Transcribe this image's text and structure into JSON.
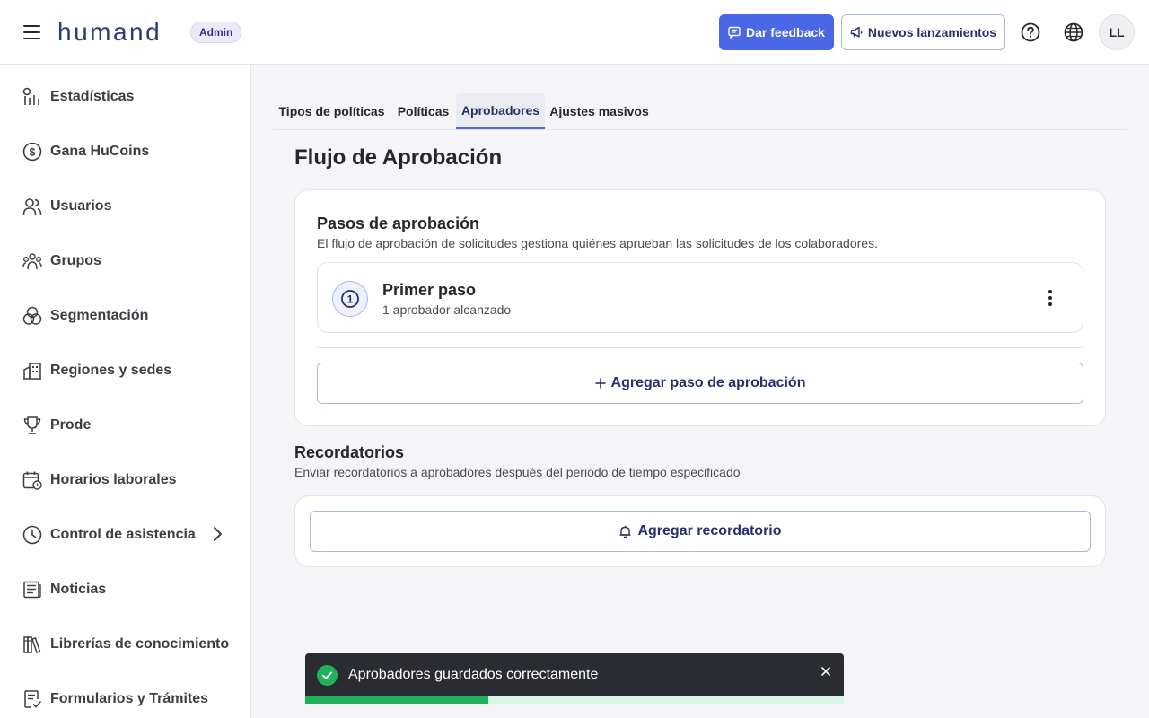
{
  "header": {
    "logo": "humand",
    "badge": "Admin",
    "feedback_label": "Dar feedback",
    "launches_label": "Nuevos lanzamientos",
    "avatar_initials": "LL"
  },
  "sidebar": {
    "items": [
      {
        "label": "Estadísticas",
        "icon": "chart-icon"
      },
      {
        "label": "Gana HuCoins",
        "icon": "coin-icon"
      },
      {
        "label": "Usuarios",
        "icon": "users-icon"
      },
      {
        "label": "Grupos",
        "icon": "group-icon"
      },
      {
        "label": "Segmentación",
        "icon": "segment-icon"
      },
      {
        "label": "Regiones y sedes",
        "icon": "building-icon"
      },
      {
        "label": "Prode",
        "icon": "trophy-icon"
      },
      {
        "label": "Horarios laborales",
        "icon": "calendar-clock-icon"
      },
      {
        "label": "Control de asistencia",
        "icon": "clock-icon"
      },
      {
        "label": "Noticias",
        "icon": "newspaper-icon"
      },
      {
        "label": "Librerías de conocimiento",
        "icon": "library-icon"
      },
      {
        "label": "Formularios y Trámites",
        "icon": "form-icon"
      }
    ]
  },
  "tabs": [
    {
      "label": "Tipos de políticas",
      "active": false
    },
    {
      "label": "Políticas",
      "active": false
    },
    {
      "label": "Aprobadores",
      "active": true
    },
    {
      "label": "Ajustes masivos",
      "active": false
    }
  ],
  "page": {
    "title": "Flujo de Aprobación"
  },
  "approval": {
    "title": "Pasos de aprobación",
    "description": "El flujo de aprobación de solicitudes gestiona quiénes aprueban las solicitudes de los colaboradores.",
    "step": {
      "number": "1",
      "title": "Primer paso",
      "subtitle": "1 aprobador alcanzado"
    },
    "add_step_label": "Agregar paso de aprobación"
  },
  "reminders": {
    "title": "Recordatorios",
    "description": "Enviar recordatorios a aprobadores después del periodo de tiempo especificado",
    "add_label": "Agregar recordatorio"
  },
  "toast": {
    "message": "Aprobadores guardados correctamente",
    "progress": 0.34
  },
  "colors": {
    "accent": "#4a67e5",
    "success": "#22b15b",
    "toast_bg": "#2b2c31"
  }
}
